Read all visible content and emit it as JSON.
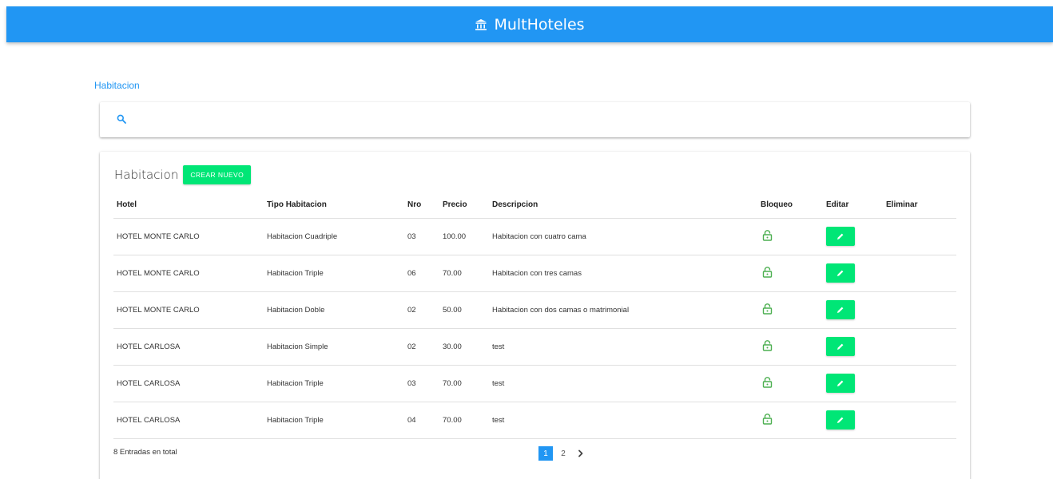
{
  "header": {
    "title": "MultHoteles",
    "icon": "hotel-icon"
  },
  "breadcrumb": "Habitacion",
  "search": {
    "icon": "search-icon"
  },
  "table_card": {
    "title": "Habitacion",
    "create_label": "CREAR NUEVO",
    "columns": [
      "Hotel",
      "Tipo Habitacion",
      "Nro",
      "Precio",
      "Descripcion",
      "Bloqueo",
      "Editar",
      "Eliminar"
    ],
    "rows": [
      {
        "hotel": "HOTEL MONTE CARLO",
        "tipo": "Habitacion Cuadriple",
        "nro": "03",
        "precio": "100.00",
        "desc": "Habitacion con cuatro cama"
      },
      {
        "hotel": "HOTEL MONTE CARLO",
        "tipo": "Habitacion Triple",
        "nro": "06",
        "precio": "70.00",
        "desc": "Habitacion con tres camas"
      },
      {
        "hotel": "HOTEL MONTE CARLO",
        "tipo": "Habitacion Doble",
        "nro": "02",
        "precio": "50.00",
        "desc": "Habitacion con dos camas o matrimonial"
      },
      {
        "hotel": "HOTEL CARLOSA",
        "tipo": "Habitacion Simple",
        "nro": "02",
        "precio": "30.00",
        "desc": "test"
      },
      {
        "hotel": "HOTEL CARLOSA",
        "tipo": "Habitacion Triple",
        "nro": "03",
        "precio": "70.00",
        "desc": "test"
      },
      {
        "hotel": "HOTEL CARLOSA",
        "tipo": "Habitacion Triple",
        "nro": "04",
        "precio": "70.00",
        "desc": "test"
      }
    ],
    "total_text": "8 Entradas en total",
    "pagination": {
      "pages": [
        "1",
        "2"
      ],
      "current": "1",
      "next_icon": "chevron-right-icon"
    }
  },
  "colors": {
    "primary": "#2196f3",
    "accent": "#00e676",
    "lock": "#4caf50"
  }
}
